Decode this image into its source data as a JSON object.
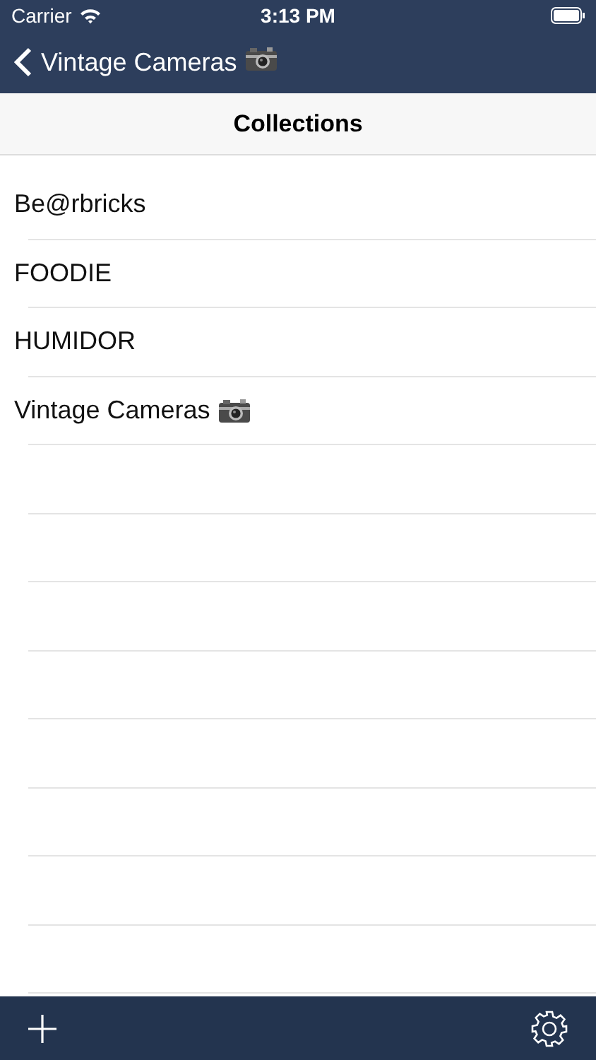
{
  "status_bar": {
    "carrier": "Carrier",
    "time": "3:13 PM"
  },
  "nav_bar": {
    "back_label": "Vintage Cameras",
    "back_has_camera": true
  },
  "header": {
    "title": "Collections"
  },
  "items": [
    {
      "label": "Be@rbricks",
      "has_camera": false
    },
    {
      "label": "FOODIE",
      "has_camera": false
    },
    {
      "label": "HUMIDOR",
      "has_camera": false
    },
    {
      "label": "Vintage Cameras",
      "has_camera": true
    }
  ]
}
